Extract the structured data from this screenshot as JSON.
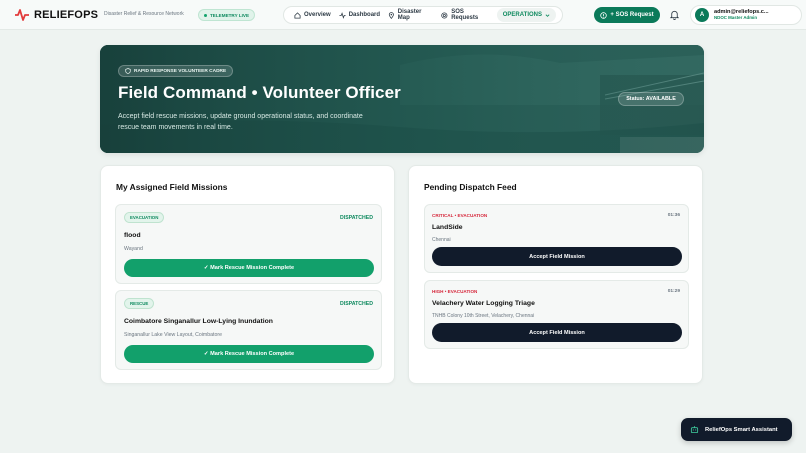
{
  "navbar": {
    "brand": "RELIEFOPS",
    "tagline": "Disaster Relief & Resource Network",
    "telemetry": "TELEMETRY LIVE",
    "links": [
      {
        "label": "Overview",
        "icon": "home-icon"
      },
      {
        "label": "Dashboard",
        "icon": "activity-icon"
      },
      {
        "label": "Disaster Map",
        "icon": "map-pin-icon"
      },
      {
        "label": "SOS Requests",
        "icon": "lifebuoy-icon"
      }
    ],
    "operations": "OPERATIONS",
    "sos_button": "+ SOS Request",
    "user": {
      "initial": "A",
      "email": "admin@reliefops.c...",
      "role": "NDOC Master Admin"
    }
  },
  "hero": {
    "badge": "RAPID RESPONSE VOLUNTEER CADRE",
    "title": "Field Command • Volunteer Officer",
    "subtitle": "Accept field rescue missions, update ground operational status, and coordinate rescue team movements in real time.",
    "status": "Status: AVAILABLE"
  },
  "missions": {
    "title": "My Assigned Field Missions",
    "items": [
      {
        "tag": "EVACUATION",
        "status": "DISPATCHED",
        "name": "flood",
        "location": "Wayand",
        "action": "✓ Mark Rescue Mission Complete"
      },
      {
        "tag": "RESCUE",
        "status": "DISPATCHED",
        "name": "Coimbatore Singanallur Low-Lying Inundation",
        "location": "Singanallur Lake View Layout, Coimbatore",
        "action": "✓ Mark Rescue Mission Complete"
      }
    ]
  },
  "dispatch": {
    "title": "Pending Dispatch Feed",
    "items": [
      {
        "priority": "CRITICAL",
        "category": "EVACUATION",
        "time": "01:36",
        "name": "LandSide",
        "location": "Chennai",
        "action": "Accept Field Mission"
      },
      {
        "priority": "HIGH",
        "category": "EVACUATION",
        "time": "01:29",
        "name": "Velachery Water Logging Triage",
        "location": "TNHB Colony 10th Street, Velachery, Chennai",
        "action": "Accept Field Mission"
      }
    ]
  },
  "assistant": {
    "label": "ReliefOps Smart Assistant"
  },
  "colors": {
    "accent": "#0b7a5a",
    "success": "#12a06b",
    "critical": "#d6283c",
    "dark": "#111b2b",
    "background": "#eef3f1"
  }
}
